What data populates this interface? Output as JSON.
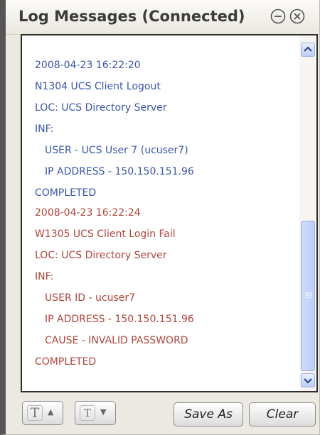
{
  "window": {
    "title": "Log Messages (Connected)",
    "minimize_icon": "minimize-icon",
    "close_icon": "close-icon"
  },
  "log": {
    "entries": [
      {
        "level": "info",
        "color": "#3a57a8",
        "timestamp": "2008-04-23 16:22:20",
        "event": "N1304 UCS Client Logout",
        "location": "LOC: UCS Directory Server",
        "info_label": "INF:",
        "details": [
          "USER - UCS User 7 (ucuser7)",
          "IP ADDRESS - 150.150.151.96"
        ],
        "status": "COMPLETED"
      },
      {
        "level": "warning",
        "color": "#b0443c",
        "timestamp": "2008-04-23 16:22:24",
        "event": "W1305 UCS Client Login Fail",
        "location": "LOC: UCS Directory Server",
        "info_label": "INF:",
        "details": [
          "USER ID - ucuser7",
          "IP ADDRESS - 150.150.151.96",
          "CAUSE - INVALID PASSWORD"
        ],
        "status": "COMPLETED"
      }
    ]
  },
  "scrollbar": {
    "up_icon": "scroll-up-arrow-icon",
    "down_icon": "scroll-down-arrow-icon",
    "accent": "#bdcef8"
  },
  "toolbar": {
    "font_increase_glyph": "T",
    "font_increase_arrow": "▲",
    "font_decrease_glyph": "T",
    "font_decrease_arrow": "▼",
    "save_label": "Save As",
    "clear_label": "Clear"
  }
}
